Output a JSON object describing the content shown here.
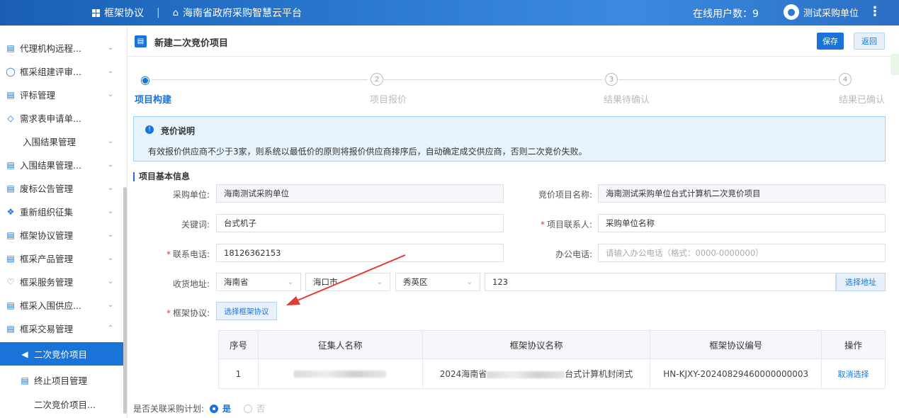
{
  "topbar": {
    "module": "框架协议",
    "platform": "海南省政府采购智慧云平台",
    "online_users": "在线用户数：9",
    "user_name": "测试采购单位"
  },
  "sidebar": {
    "items": [
      {
        "label": "代理机构远程...",
        "icon": "agency-icon"
      },
      {
        "label": "框采组建评审...",
        "icon": "team-icon"
      },
      {
        "label": "评标管理",
        "icon": "evaluation-icon"
      },
      {
        "label": "需求表申请单...",
        "icon": "diamond-icon"
      },
      {
        "label": "入围结果管理",
        "icon": ""
      },
      {
        "label": "入围结果管理...",
        "icon": "result-icon"
      },
      {
        "label": "废标公告管理",
        "icon": "announcement-icon"
      },
      {
        "label": "重新组织征集",
        "icon": "reorganize-icon"
      },
      {
        "label": "框架协议管理",
        "icon": "agreement-icon"
      },
      {
        "label": "框采产品管理",
        "icon": "product-icon"
      },
      {
        "label": "框采服务管理",
        "icon": "service-icon"
      },
      {
        "label": "框采入围供应...",
        "icon": "supplier-icon"
      },
      {
        "label": "框采交易管理",
        "icon": "trade-icon"
      },
      {
        "label": "二次竞价项目",
        "icon": "bidding-icon"
      },
      {
        "label": "终止项目管理",
        "icon": "terminate-icon"
      },
      {
        "label": "二次竞价项目...",
        "icon": ""
      }
    ]
  },
  "page": {
    "title": "新建二次竞价项目",
    "save": "保存",
    "back": "返回"
  },
  "steps": [
    {
      "num": "1",
      "label": "项目构建"
    },
    {
      "num": "2",
      "label": "项目报价"
    },
    {
      "num": "3",
      "label": "结果待确认"
    },
    {
      "num": "4",
      "label": "结果已确认"
    }
  ],
  "notice": {
    "title": "竞价说明",
    "text": "有效报价供应商不少于3家，则系统以最低价的原则将报价供应商排序后，自动确定成交供应商，否则二次竞价失败。"
  },
  "form": {
    "section": "项目基本信息",
    "purchaser_label": "采购单位:",
    "purchaser_value": "海南测试采购单位",
    "project_name_label": "竞价项目名称:",
    "project_name_value": "海南测试采购单位台式计算机二次竞价项目",
    "keyword_label": "关键词:",
    "keyword_value": "台式机子",
    "contact_label": "项目联系人:",
    "contact_value": "采购单位名称",
    "phone_label": "联系电话:",
    "phone_value": "18126362153",
    "office_phone_label": "办公电话:",
    "office_phone_placeholder": "请输入办公电话（格式：0000-0000000）",
    "address_label": "收货地址:",
    "province": "海南省",
    "city": "海口市",
    "district": "秀英区",
    "address_detail": "123",
    "choose_address": "选择地址",
    "agreement_label": "框架协议:",
    "choose_agreement": "选择框架协议",
    "required_mark": "*"
  },
  "table": {
    "headers": [
      "序号",
      "征集人名称",
      "框架协议名称",
      "框架协议编号",
      "操作"
    ],
    "rows": [
      {
        "index": "1",
        "collector": "",
        "agreement_name_prefix": "2024海南省",
        "agreement_name_suffix": "台式计算机封闭式",
        "agreement_no": "HN-KJXY-20240829460000000003",
        "action": "取消选择"
      }
    ]
  },
  "plan": {
    "label": "是否关联采购计划:",
    "yes": "是",
    "no": "否"
  },
  "colors": {
    "primary": "#1a73d9",
    "annotation_arrow": "#e53935"
  }
}
